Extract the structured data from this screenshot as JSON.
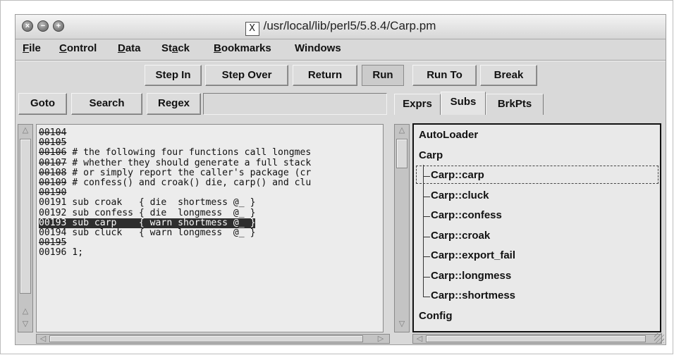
{
  "window": {
    "title": "/usr/local/lib/perl5/5.8.4/Carp.pm"
  },
  "menubar": [
    {
      "underline": "F",
      "rest": "ile"
    },
    {
      "underline": "C",
      "rest": "ontrol"
    },
    {
      "underline": "D",
      "rest": "ata"
    },
    {
      "pre": "St",
      "underline": "a",
      "rest": "ck"
    },
    {
      "underline": "B",
      "rest": "ookmarks"
    },
    {
      "label": "Windows"
    }
  ],
  "toolbar": {
    "step_in": "Step In",
    "step_over": "Step Over",
    "return": "Return",
    "run": "Run",
    "run_to": "Run To",
    "break": "Break"
  },
  "search_bar": {
    "goto": "Goto",
    "search": "Search",
    "regex": "Regex",
    "input_value": ""
  },
  "code": {
    "lines": [
      {
        "num": "00104",
        "text": "",
        "struck": true
      },
      {
        "num": "00105",
        "text": "",
        "struck": true
      },
      {
        "num": "00106",
        "text": " # the following four functions call longmes",
        "struck": true
      },
      {
        "num": "00107",
        "text": " # whether they should generate a full stack",
        "struck": true
      },
      {
        "num": "00108",
        "text": " # or simply report the caller's package (cr",
        "struck": true
      },
      {
        "num": "00109",
        "text": " # confess() and croak() die, carp() and clu",
        "struck": true
      },
      {
        "num": "00190",
        "text": "",
        "struck": true
      },
      {
        "num": "00191",
        "text": " sub croak   { die  shortmess @_ }",
        "struck": false
      },
      {
        "num": "00192",
        "text": " sub confess { die  longmess  @_ }",
        "struck": false
      },
      {
        "num": "00193",
        "text": " sub carp    { warn shortmess @_ }",
        "struck": false,
        "selected": true
      },
      {
        "num": "00194",
        "text": " sub cluck   { warn longmess  @_ }",
        "struck": false
      },
      {
        "num": "00195",
        "text": "",
        "struck": true
      },
      {
        "num": "00196",
        "text": " 1;",
        "struck": false
      }
    ]
  },
  "tabs": [
    "Exprs",
    "Subs",
    "BrkPts"
  ],
  "active_tab": "Subs",
  "tree": {
    "items": [
      {
        "label": "AutoLoader",
        "level": 0
      },
      {
        "label": "Carp",
        "level": 0
      },
      {
        "label": "Carp::carp",
        "level": 1,
        "selected": true
      },
      {
        "label": "Carp::cluck",
        "level": 1
      },
      {
        "label": "Carp::confess",
        "level": 1
      },
      {
        "label": "Carp::croak",
        "level": 1
      },
      {
        "label": "Carp::export_fail",
        "level": 1
      },
      {
        "label": "Carp::longmess",
        "level": 1
      },
      {
        "label": "Carp::shortmess",
        "level": 1
      },
      {
        "label": "Config",
        "level": 0
      }
    ]
  },
  "icons": {
    "close": "close-icon",
    "minimize": "minimize-icon",
    "zoom": "zoom-icon",
    "x11": "x11-icon"
  },
  "colors": {
    "window_bg": "#d9d9d9",
    "selection_bg": "#2e2e2e",
    "selection_fg": "#ffffff"
  }
}
